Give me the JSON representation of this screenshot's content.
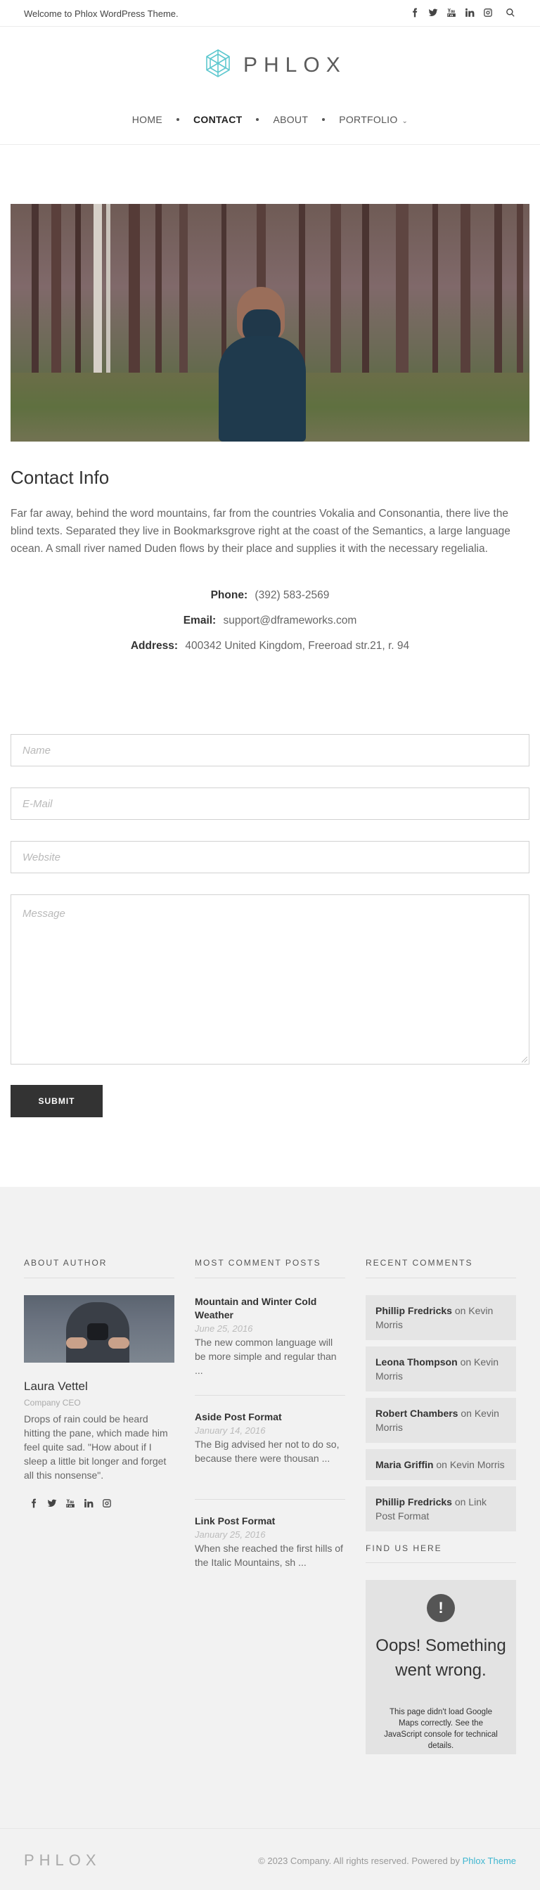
{
  "topbar": {
    "welcome": "Welcome to Phlox WordPress Theme.",
    "social_icons": [
      "facebook-icon",
      "twitter-icon",
      "youtube-icon",
      "linkedin-icon",
      "instagram-icon",
      "search-icon"
    ]
  },
  "header": {
    "logo_text": "PHLOX",
    "nav": [
      {
        "label": "HOME"
      },
      {
        "label": "CONTACT",
        "active": true
      },
      {
        "label": "ABOUT"
      },
      {
        "label": "PORTFOLIO",
        "has_dropdown": true
      }
    ]
  },
  "contact": {
    "title": "Contact Info",
    "text": "Far far away, behind the word mountains, far from the countries Vokalia and Consonantia, there live the blind texts. Separated they live in Bookmarksgrove right at the coast of the Semantics, a large language ocean. A small river named Duden flows by their place and supplies it with the necessary regelialia.",
    "phone_label": "Phone:",
    "phone": "(392) 583-2569",
    "email_label": "Email:",
    "email": "support@dframeworks.com",
    "address_label": "Address:",
    "address": "400342 United Kingdom, Freeroad str.21, r. 94"
  },
  "form": {
    "name_placeholder": "Name",
    "email_placeholder": "E-Mail",
    "website_placeholder": "Website",
    "message_placeholder": "Message",
    "submit": "SUBMIT"
  },
  "footer": {
    "about": {
      "title": "ABOUT AUTHOR",
      "name": "Laura Vettel",
      "role": "Company CEO",
      "bio": "Drops of rain could be heard hitting the pane, which made him feel quite sad. \"How about if I sleep a little bit longer and forget all this nonsense\"."
    },
    "posts": {
      "title": "MOST COMMENT POSTS",
      "items": [
        {
          "title": "Mountain and Winter Cold Weather",
          "date": "June 25, 2016",
          "excerpt": "The new common language will be more simple and regular than ..."
        },
        {
          "title": "Aside Post Format",
          "date": "January 14, 2016",
          "excerpt": "The Big advised her not to do so, because there were thousan ..."
        },
        {
          "title": "Link Post Format",
          "date": "January 25, 2016",
          "excerpt": "When she reached the first hills of the Italic Mountains, sh ..."
        }
      ]
    },
    "comments": {
      "title": "RECENT COMMENTS",
      "items": [
        {
          "author": "Phillip Fredricks",
          "on": "on",
          "post": "Kevin Morris"
        },
        {
          "author": "Leona Thompson",
          "on": "on",
          "post": "Kevin Morris"
        },
        {
          "author": "Robert Chambers",
          "on": "on",
          "post": "Kevin Morris"
        },
        {
          "author": "Maria Griffin",
          "on": "on",
          "post": "Kevin Morris"
        },
        {
          "author": "Phillip Fredricks",
          "on": "on",
          "post": "Link Post Format"
        }
      ]
    },
    "find_us": {
      "title": "FIND US HERE",
      "icon": "!",
      "oops": "Oops! Something went wrong.",
      "oops_detail": "This page didn't load Google Maps correctly. See the JavaScript console for technical details."
    }
  },
  "bottom": {
    "logo_text": "PHLOX",
    "copyright": "© 2023 Company. All rights reserved. Powered by",
    "theme_link": "Phlox Theme"
  },
  "colors": {
    "accent": "#3fb6d0",
    "logo_mark": "#5ec8cf",
    "dark_button": "#333333",
    "footer_bg": "#f2f2f2"
  }
}
